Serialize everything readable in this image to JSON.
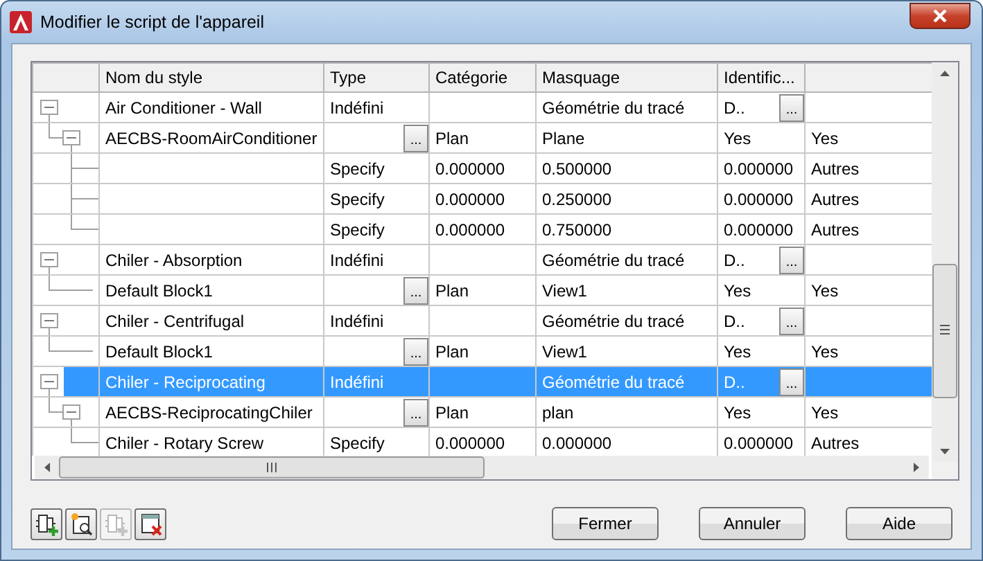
{
  "window": {
    "title": "Modifier le script de l'appareil"
  },
  "table": {
    "columns": [
      "Nom du style",
      "Type",
      "Catégorie",
      "Masquage",
      "Identific..."
    ],
    "rows": [
      {
        "name": "Air Conditioner - Wall",
        "type": "Indéfini",
        "mask": "Géométrie du tracé",
        "identification": "D..",
        "identification_button": "...",
        "selected": false,
        "expanded": true,
        "children": [
          {
            "name": "AECBS-RoomAirConditioner",
            "type_button": "...",
            "category": "Plan",
            "mask": "Plane",
            "identification": "Yes",
            "column_7": "Yes",
            "selected": false,
            "expanded": true,
            "children": [
              {
                "type": "Specify",
                "category": "0.000000",
                "mask": "0.500000",
                "identification": "0.000000",
                "column_7": "Autres",
                "selected": false
              },
              {
                "type": "Specify",
                "category": "0.000000",
                "mask": "0.250000",
                "identification": "0.000000",
                "column_7": "Autres",
                "selected": false
              },
              {
                "type": "Specify",
                "category": "0.000000",
                "mask": "0.750000",
                "identification": "0.000000",
                "column_7": "Autres",
                "selected": false
              }
            ]
          }
        ]
      },
      {
        "name": "Chiler - Absorption",
        "type": "Indéfini",
        "mask": "Géométrie du tracé",
        "identification": "D..",
        "identification_button": "...",
        "selected": false,
        "expanded": true,
        "children": [
          {
            "name": "Default Block1",
            "type_button": "...",
            "category": "Plan",
            "mask": "View1",
            "identification": "Yes",
            "column_7": "Yes",
            "selected": false
          }
        ]
      },
      {
        "name": "Chiler - Centrifugal",
        "type": "Indéfini",
        "mask": "Géométrie du tracé",
        "identification": "D..",
        "identification_button": "...",
        "selected": false,
        "expanded": true,
        "children": [
          {
            "name": "Default Block1",
            "type_button": "...",
            "category": "Plan",
            "mask": "View1",
            "identification": "Yes",
            "column_7": "Yes",
            "selected": false
          }
        ]
      },
      {
        "name": "Chiler - Reciprocating",
        "type": "Indéfini",
        "mask": "Géométrie du tracé",
        "identification": "D..",
        "identification_button": "...",
        "selected": true,
        "expanded": true,
        "children": [
          {
            "name": "AECBS-ReciprocatingChiler",
            "type_button": "...",
            "category": "Plan",
            "mask": "plan",
            "identification": "Yes",
            "column_7": "Yes",
            "selected": false,
            "expanded": true,
            "children": [
              {
                "name": "Chiler - Rotary Screw",
                "type": "Specify",
                "category": "0.000000",
                "mask": "0.000000",
                "identification": "0.000000",
                "column_7": "Autres",
                "selected": false
              }
            ]
          }
        ]
      }
    ]
  },
  "toolbar": [
    {
      "kind": "add",
      "disabled": false
    },
    {
      "kind": "new",
      "disabled": false
    },
    {
      "kind": "add",
      "disabled": true
    },
    {
      "kind": "delete",
      "disabled": false
    }
  ],
  "buttons": [
    "Fermer",
    "Annuler",
    "Aide"
  ]
}
